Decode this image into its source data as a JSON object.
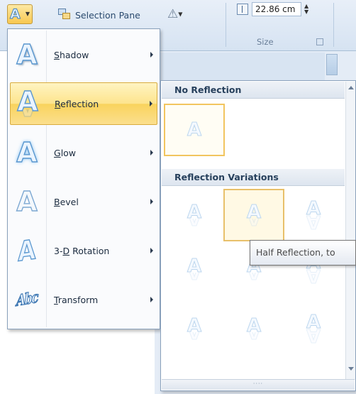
{
  "ribbon": {
    "selection_pane_label": "Selection Pane",
    "size_value": "22.86 cm",
    "size_group_label": "Size",
    "icons": [
      "text-effects-icon",
      "selection-pane-icon",
      "rotate-icon",
      "height-icon",
      "dialog-launcher-icon"
    ]
  },
  "menu": {
    "items": [
      {
        "key": "S",
        "rest": "hadow",
        "icon": "shadow-effect-icon"
      },
      {
        "key": "R",
        "rest": "eflection",
        "icon": "reflection-effect-icon",
        "active": true
      },
      {
        "key": "G",
        "rest": "low",
        "icon": "glow-effect-icon"
      },
      {
        "key": "B",
        "rest": "evel",
        "icon": "bevel-effect-icon"
      },
      {
        "pre": "3-",
        "key": "D",
        "rest": " Rotation",
        "icon": "3d-rotation-effect-icon"
      },
      {
        "key": "T",
        "rest": "ransform",
        "icon": "transform-effect-icon"
      }
    ]
  },
  "gallery": {
    "no_reflection_header": "No Reflection",
    "variations_header": "Reflection Variations",
    "variations": [
      "tight",
      "half-hovered",
      "full",
      "tight",
      "half",
      "full",
      "tight",
      "half",
      "full"
    ]
  },
  "tooltip": {
    "text": "Half Reflection, to"
  },
  "colors": {
    "accent_highlight": "#f9d35d",
    "menu_border": "#8aa1bc",
    "icon_stroke": "#5a97cf"
  }
}
